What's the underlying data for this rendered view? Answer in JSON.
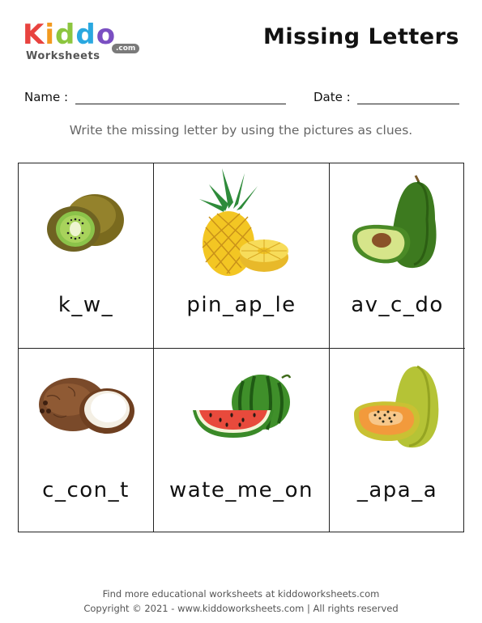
{
  "logo": {
    "letters": [
      {
        "char": "K",
        "color": "#e8433f"
      },
      {
        "char": "i",
        "color": "#f29a1f"
      },
      {
        "char": "d",
        "color": "#8cc63f"
      },
      {
        "char": "d",
        "color": "#2aa8e0"
      },
      {
        "char": "o",
        "color": "#7a4fc2"
      }
    ],
    "subtext": "Worksheets",
    "domain_badge": ".com"
  },
  "title": "Missing Letters",
  "fields": {
    "name_label": "Name :",
    "date_label": "Date :"
  },
  "instruction": "Write the missing letter by using the pictures as clues.",
  "items": [
    {
      "fruit_icon": "kiwi-icon",
      "word": "k_w_"
    },
    {
      "fruit_icon": "pineapple-icon",
      "word": "pin_ap_le"
    },
    {
      "fruit_icon": "avocado-icon",
      "word": "av_c_do"
    },
    {
      "fruit_icon": "coconut-icon",
      "word": "c_con_t"
    },
    {
      "fruit_icon": "watermelon-icon",
      "word": "wate_me_on"
    },
    {
      "fruit_icon": "papaya-icon",
      "word": "_apa_a"
    }
  ],
  "footer": {
    "line1": "Find more educational worksheets at kiddoworksheets.com",
    "line2": "Copyright © 2021 - www.kiddoworksheets.com  |  All rights reserved"
  }
}
